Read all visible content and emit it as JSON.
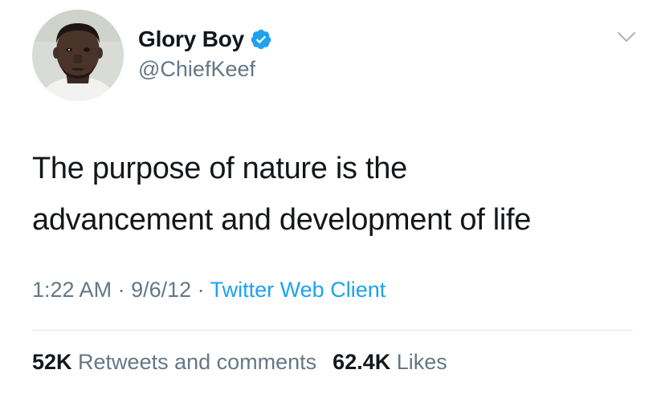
{
  "author": {
    "display_name": "Glory Boy",
    "handle": "@ChiefKeef",
    "verified": true,
    "avatar_icon": "profile-photo"
  },
  "tweet": {
    "text_lines": [
      "The purpose of nature is the",
      "advancement and development of life"
    ]
  },
  "meta": {
    "time": "1:22 AM",
    "sep1": " · ",
    "date": "9/6/12",
    "sep2": " · ",
    "source": "Twitter Web Client"
  },
  "stats": {
    "retweets_count": "52K",
    "retweets_label": " Retweets and comments",
    "likes_count": "62.4K",
    "likes_label": " Likes"
  },
  "colors": {
    "text": "#14171a",
    "secondary": "#657786",
    "accent": "#1da1f2",
    "divider": "#e1e8ed"
  },
  "icons": {
    "verified": "verified-badge-icon",
    "menu": "chevron-down-icon"
  }
}
